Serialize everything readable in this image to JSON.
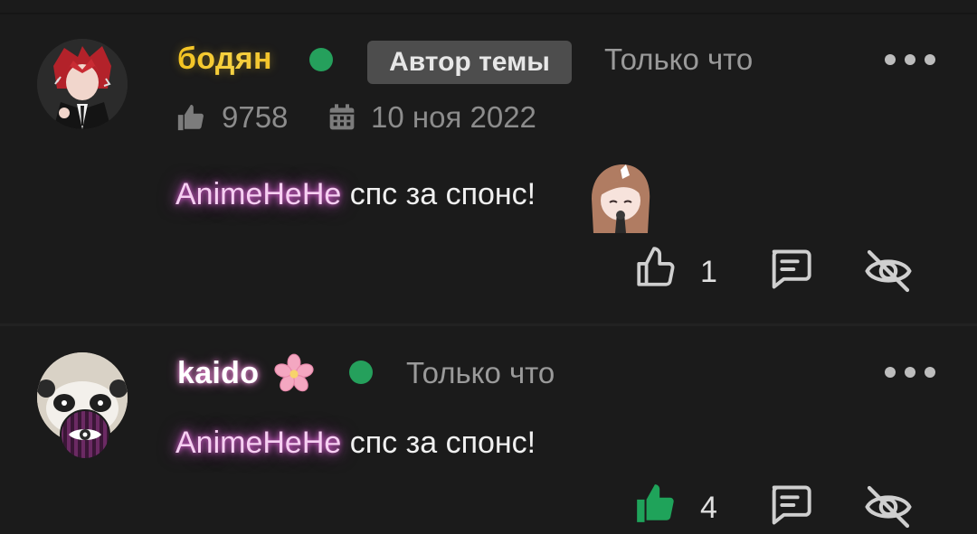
{
  "comments": [
    {
      "username": "бодян",
      "badge": "Автор темы",
      "time": "Только что",
      "likes_total": "9758",
      "date": "10 ноя 2022",
      "mention": "AnimeHeHe",
      "text": "спс за спонс!",
      "like_count": "1",
      "liked": false
    },
    {
      "username": "kaido",
      "time": "Только что",
      "mention": "AnimeHeHe",
      "text": "спс за спонс!",
      "like_count": "4",
      "liked": true
    }
  ],
  "colors": {
    "background": "#1b1b1b",
    "online": "#25a05c",
    "liked": "#1fa35a",
    "mention_glow": "#d65ad6",
    "author_name": "#f4c21f"
  },
  "icons": [
    "thumbs-up-icon",
    "calendar-icon",
    "reply-icon",
    "hide-icon",
    "more-icon",
    "sakura-icon"
  ]
}
